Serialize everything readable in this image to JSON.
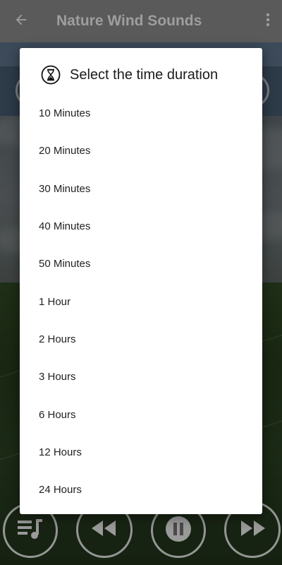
{
  "app_bar": {
    "title": "Nature Wind Sounds",
    "back_icon": "arrow-left-icon",
    "more_icon": "more-vertical-icon"
  },
  "dialog": {
    "title": "Select the time duration",
    "icon": "hourglass-icon",
    "options": [
      "10 Minutes",
      "20 Minutes",
      "30 Minutes",
      "40 Minutes",
      "50 Minutes",
      "1 Hour",
      "2 Hours",
      "3 Hours",
      "6 Hours",
      "12 Hours",
      "24 Hours"
    ]
  },
  "player": {
    "controls": [
      "playlist-icon",
      "rewind-icon",
      "pause-icon",
      "fast-forward-icon"
    ]
  },
  "colors": {
    "app_bar": "#5a5a5a",
    "dialog_bg": "#ffffff",
    "dim_overlay": "rgba(0,0,0,0.48)"
  }
}
